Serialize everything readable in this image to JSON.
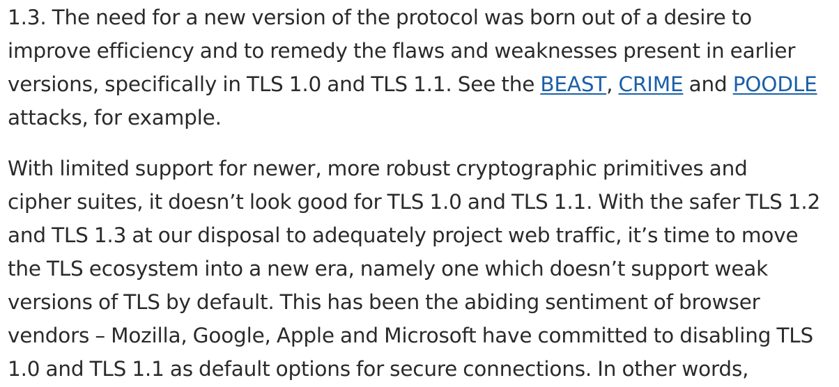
{
  "article": {
    "paragraph_1": {
      "line_1": "1.3. The need for a new version of the protocol was born out of a desire to",
      "line_2": "improve efficiency and to remedy the flaws and weaknesses present in earlier",
      "line_3_start": "versions, specifically in TLS 1.0 and TLS 1.1. See the ",
      "link_beast": "BEAST",
      "sep_comma": ", ",
      "link_crime": "CRIME",
      "sep_and": " and ",
      "link_poodle": "POODLE",
      "line_4": "attacks, for example."
    },
    "paragraph_2": {
      "line_1": "With limited support for newer, more robust cryptographic primitives and",
      "line_2": "cipher suites, it doesn’t look good for TLS 1.0 and TLS 1.1. With the safer TLS 1.2",
      "line_3": "and TLS 1.3 at our disposal to adequately project web traffic, it’s time to move",
      "line_4": "the TLS ecosystem into a new era, namely one which doesn’t support weak",
      "line_5": "versions of TLS by default. This has been the abiding sentiment of browser",
      "line_6": "vendors – Mozilla, Google, Apple and Microsoft have committed to disabling TLS",
      "line_7": "1.0 and TLS 1.1 as default options for secure connections. In other words,"
    }
  },
  "colors": {
    "text": "#2a2a2a",
    "link": "#1a5fa8",
    "background": "#ffffff"
  }
}
